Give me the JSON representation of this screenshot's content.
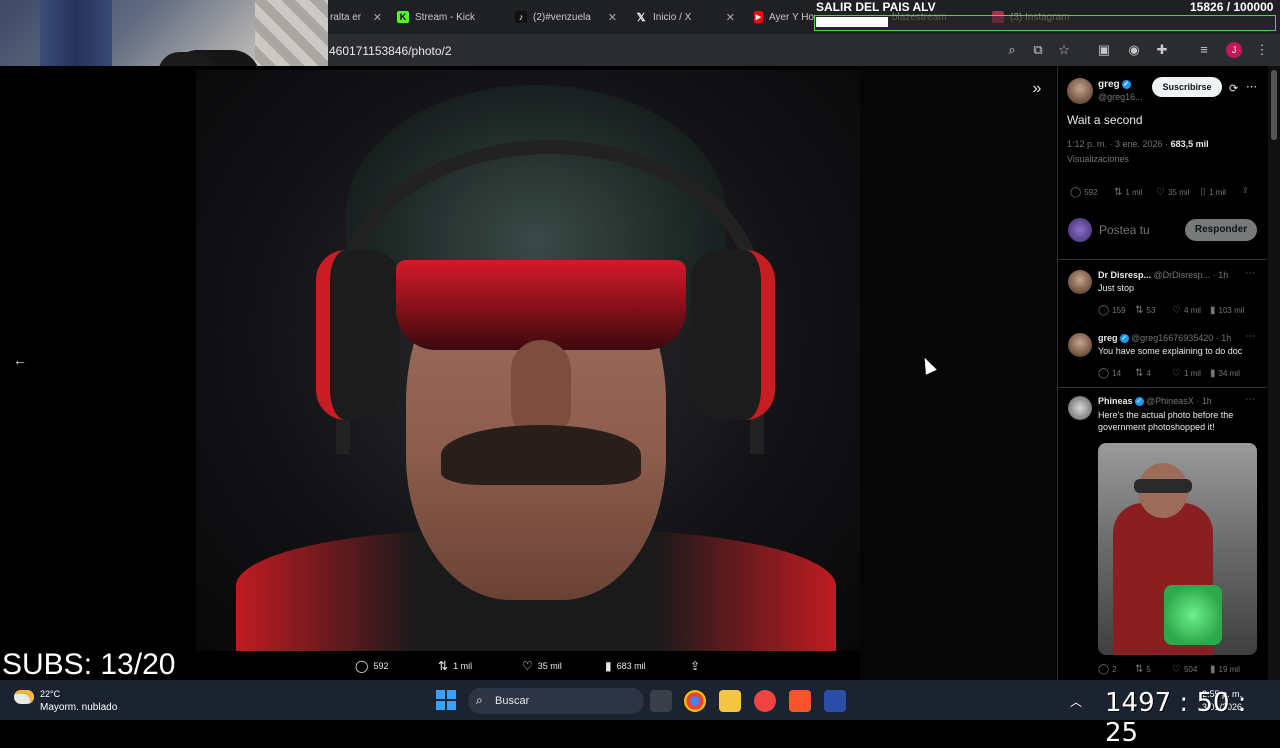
{
  "browser": {
    "tabs": [
      {
        "label": "ralta er",
        "icon": "generic-tab-icon"
      },
      {
        "label": "Stream - Kick",
        "icon": "kick-icon",
        "color": "#53fc18"
      },
      {
        "label": "(2)#venzuela",
        "icon": "tiktok-icon"
      },
      {
        "label": "Inicio / X",
        "icon": "x-logo-icon"
      },
      {
        "label": "Ayer Y Ho",
        "icon": "youtube-icon",
        "color": "#ff0000"
      },
      {
        "label": "blazestream",
        "icon": "generic-tab-icon"
      },
      {
        "label": "(3) Instagram",
        "icon": "instagram-icon",
        "color": "#e1306c"
      }
    ],
    "url": "460171153846/photo/2"
  },
  "overlay": {
    "title": "SALIR DEL PAIS ALV",
    "count": "15826 / 100000",
    "progress": 0.158
  },
  "viewer": {
    "actions": {
      "replies": "592",
      "reposts": "1 mil",
      "likes": "35 mil",
      "views": "683 mil"
    }
  },
  "panel": {
    "author": {
      "name": "greg",
      "handle": "@greg16..."
    },
    "subscribe_label": "Suscribirse",
    "tweet_text": "Wait a second",
    "meta_time": "1:12 p. m. · 3 ene. 2026 · ",
    "meta_views": "683,5 mil",
    "meta_views_label": "Visualizaciones",
    "stats": {
      "replies": "592",
      "reposts": "1 mil",
      "likes": "35 mil",
      "bookmarks": "1 mil"
    },
    "reply_placeholder": "Postea tu",
    "reply_button": "Responder",
    "replies": [
      {
        "name": "Dr Disresp...",
        "handle": "@DrDisresp...",
        "time": "· 1h",
        "text": "Just stop",
        "stats": {
          "replies": "159",
          "reposts": "53",
          "likes": "4 mil",
          "views": "103 mil"
        }
      },
      {
        "name": "greg",
        "handle": "@greg16676935420",
        "time": "· 1h",
        "text": "You have some explaining to do doc",
        "stats": {
          "replies": "14",
          "reposts": "4",
          "likes": "1 mil",
          "views": "34 mil"
        }
      },
      {
        "name": "Phineas",
        "handle": "@PhineasX",
        "time": "· 1h",
        "text": "Here's the actual photo before the government photoshopped it!",
        "stats": {
          "replies": "2",
          "reposts": "5",
          "likes": "504",
          "views": "19 mil"
        }
      }
    ]
  },
  "stream": {
    "subs": "SUBS: 13/20",
    "timer": "1497 : 50 : 25"
  },
  "taskbar": {
    "temperature": "22°C",
    "weather": "Mayorm. nublado",
    "search_label": "Buscar",
    "time": "2:55 p. m.",
    "date": "3/01/2026"
  }
}
